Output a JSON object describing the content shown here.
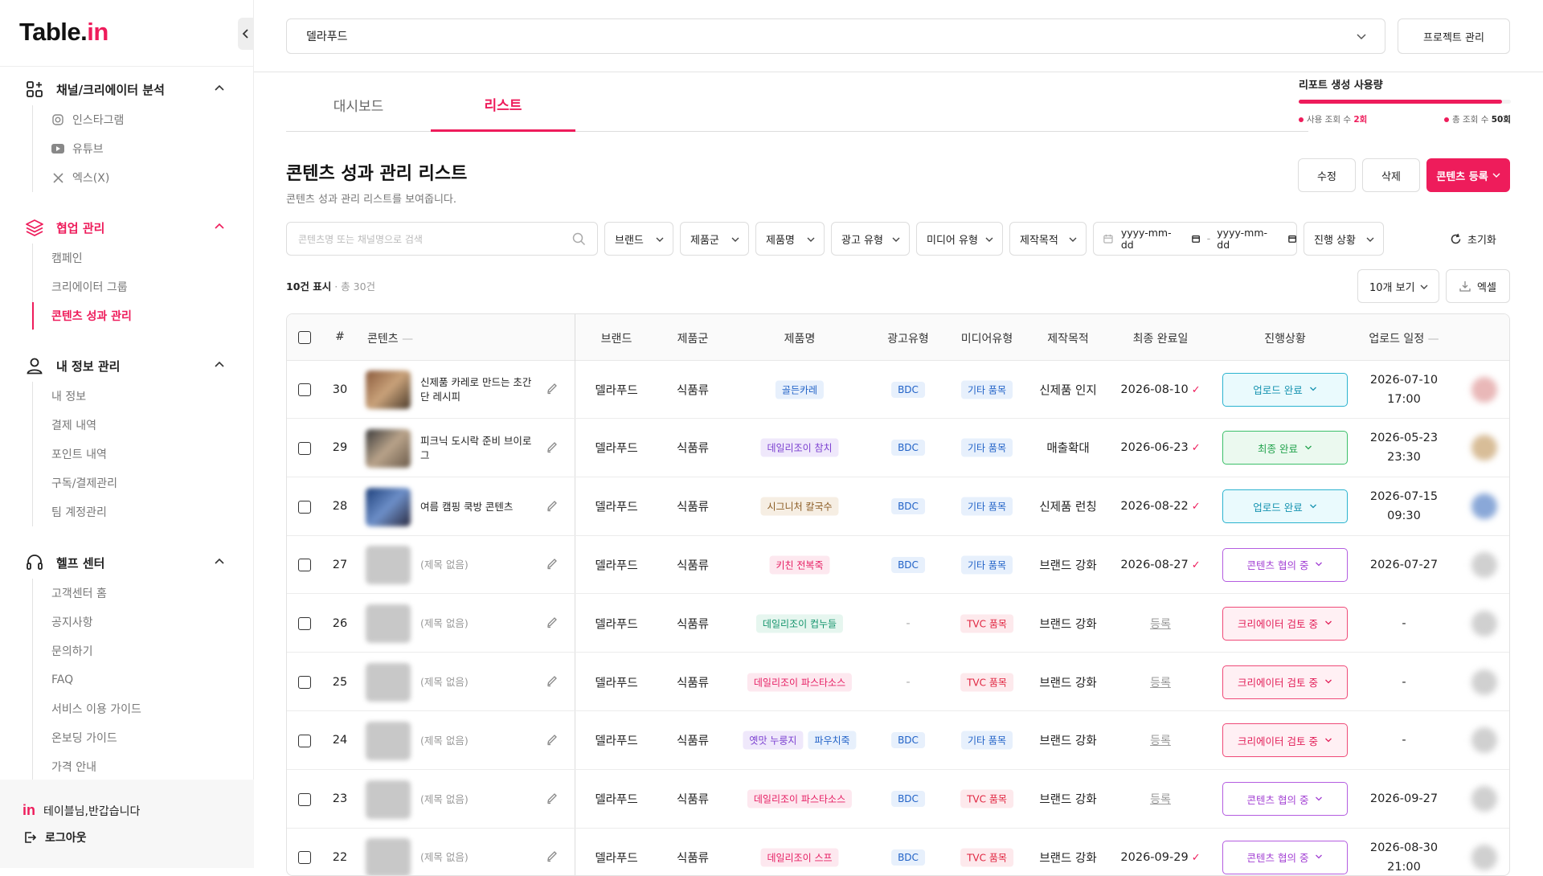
{
  "app": {
    "logo_main": "Table.",
    "logo_accent": "in"
  },
  "sidebar": {
    "sections": [
      {
        "label": "채널/크리에이터 분석",
        "items": [
          {
            "label": "인스타그램"
          },
          {
            "label": "유튜브"
          },
          {
            "label": "엑스(X)"
          }
        ]
      },
      {
        "label": "협업 관리",
        "items": [
          {
            "label": "캠페인"
          },
          {
            "label": "크리에이터 그룹"
          },
          {
            "label": "콘텐츠 성과 관리"
          }
        ]
      },
      {
        "label": "내 정보 관리",
        "items": [
          {
            "label": "내 정보"
          },
          {
            "label": "결제 내역"
          },
          {
            "label": "포인트 내역"
          },
          {
            "label": "구독/결제관리"
          },
          {
            "label": "팀 계정관리"
          }
        ]
      },
      {
        "label": "헬프 센터",
        "items": [
          {
            "label": "고객센터 홈"
          },
          {
            "label": "공지사항"
          },
          {
            "label": "문의하기"
          },
          {
            "label": "FAQ"
          },
          {
            "label": "서비스 이용 가이드"
          },
          {
            "label": "온보딩 가이드"
          },
          {
            "label": "가격 안내"
          }
        ]
      }
    ],
    "footer": {
      "greeting": "테이블님,반갑습니다",
      "logout": "로그아웃"
    }
  },
  "header": {
    "project_select": "델라푸드",
    "manage_button": "프로젝트 관리"
  },
  "tabs": [
    {
      "label": "대시보드"
    },
    {
      "label": "리스트"
    }
  ],
  "usage": {
    "title": "리포트 생성 사용량",
    "used_label": "사용 조회 수",
    "used_value": "2회",
    "total_label": "총 조회 수",
    "total_value": "50회",
    "ratio": 0.96
  },
  "page": {
    "title": "콘텐츠 성과 관리 리스트",
    "subtitle": "콘텐츠 성과 관리 리스트를 보여줍니다."
  },
  "actions": {
    "edit": "수정",
    "delete": "삭제",
    "register": "콘텐츠 등록"
  },
  "filters": {
    "search_placeholder": "콘텐츠명 또는 채널명으로 검색",
    "brand": "브랜드",
    "category": "제품군",
    "product": "제품명",
    "ad_type": "광고 유형",
    "media_type": "미디어 유형",
    "purpose": "제작목적",
    "date_from": "yyyy-mm-dd",
    "date_to": "yyyy-mm-dd",
    "progress": "진행 상황",
    "reset": "초기화"
  },
  "list_meta": {
    "shown": "10건 표시",
    "total": "· 총 30건",
    "per_page": "10개 보기",
    "excel": "엑셀"
  },
  "table": {
    "headers": {
      "num": "#",
      "content": "콘텐츠",
      "brand": "브랜드",
      "category": "제품군",
      "product": "제품명",
      "ad_type": "광고유형",
      "media_type": "미디어유형",
      "purpose": "제작목적",
      "final_date": "최종 완료일",
      "status": "진행상황",
      "upload": "업로드 일정"
    },
    "rows": [
      {
        "num": "30",
        "title": "신제품 카레로 만드는 초간단 레시피",
        "brand": "델라푸드",
        "category": "식품류",
        "products": [
          {
            "label": "골든카레",
            "color": "blue"
          }
        ],
        "ad_type": "BDC",
        "media": "기타 품목",
        "media_color": "blue",
        "purpose": "신제품 인지",
        "final_date": "2026-08-10",
        "final_check": true,
        "status": "업로드 완료",
        "status_kind": "upload",
        "upload_date": "2026-07-10",
        "upload_time": "17:00"
      },
      {
        "num": "29",
        "title": "피크닉 도시락 준비 브이로그",
        "brand": "델라푸드",
        "category": "식품류",
        "products": [
          {
            "label": "데일리조이 참치",
            "color": "purple"
          }
        ],
        "ad_type": "BDC",
        "media": "기타 품목",
        "media_color": "blue",
        "purpose": "매출확대",
        "final_date": "2026-06-23",
        "final_check": true,
        "status": "최종 완료",
        "status_kind": "final",
        "upload_date": "2026-05-23",
        "upload_time": "23:30"
      },
      {
        "num": "28",
        "title": "여름 캠핑 쿡방 콘텐츠",
        "brand": "델라푸드",
        "category": "식품류",
        "products": [
          {
            "label": "시그니처 칼국수",
            "color": "brown"
          }
        ],
        "ad_type": "BDC",
        "media": "기타 품목",
        "media_color": "blue",
        "purpose": "신제품 런칭",
        "final_date": "2026-08-22",
        "final_check": true,
        "status": "업로드 완료",
        "status_kind": "upload",
        "upload_date": "2026-07-15",
        "upload_time": "09:30"
      },
      {
        "num": "27",
        "title": "(제목 없음)",
        "brand": "델라푸드",
        "category": "식품류",
        "products": [
          {
            "label": "키친 전복죽",
            "color": "pink"
          }
        ],
        "ad_type": "BDC",
        "media": "기타 품목",
        "media_color": "blue",
        "purpose": "브랜드 강화",
        "final_date": "2026-08-27",
        "final_check": true,
        "status": "콘텐츠 협의 중",
        "status_kind": "consult",
        "upload_date": "2026-07-27",
        "upload_time": ""
      },
      {
        "num": "26",
        "title": "(제목 없음)",
        "brand": "델라푸드",
        "category": "식품류",
        "products": [
          {
            "label": "데일리조이 컵누들",
            "color": "green"
          }
        ],
        "ad_type": "-",
        "media": "TVC 품목",
        "media_color": "red",
        "purpose": "브랜드 강화",
        "final_date": "등록",
        "final_check": false,
        "status": "크리에이터 검토 중",
        "status_kind": "review",
        "upload_date": "-",
        "upload_time": ""
      },
      {
        "num": "25",
        "title": "(제목 없음)",
        "brand": "델라푸드",
        "category": "식품류",
        "products": [
          {
            "label": "데일리조이 파스타소스",
            "color": "pink"
          }
        ],
        "ad_type": "-",
        "media": "TVC 품목",
        "media_color": "red",
        "purpose": "브랜드 강화",
        "final_date": "등록",
        "final_check": false,
        "status": "크리에이터 검토 중",
        "status_kind": "review",
        "upload_date": "-",
        "upload_time": ""
      },
      {
        "num": "24",
        "title": "(제목 없음)",
        "brand": "델라푸드",
        "category": "식품류",
        "products": [
          {
            "label": "옛맛 누룽지",
            "color": "purple"
          },
          {
            "label": "파우치죽",
            "color": "blue"
          }
        ],
        "ad_type": "BDC",
        "media": "기타 품목",
        "media_color": "blue",
        "purpose": "브랜드 강화",
        "final_date": "등록",
        "final_check": false,
        "status": "크리에이터 검토 중",
        "status_kind": "review",
        "upload_date": "-",
        "upload_time": ""
      },
      {
        "num": "23",
        "title": "(제목 없음)",
        "brand": "델라푸드",
        "category": "식품류",
        "products": [
          {
            "label": "데일리조이 파스타소스",
            "color": "pink"
          }
        ],
        "ad_type": "BDC",
        "media": "TVC 품목",
        "media_color": "red",
        "purpose": "브랜드 강화",
        "final_date": "등록",
        "final_check": false,
        "status": "콘텐츠 협의 중",
        "status_kind": "consult",
        "upload_date": "2026-09-27",
        "upload_time": ""
      },
      {
        "num": "22",
        "title": "(제목 없음)",
        "brand": "델라푸드",
        "category": "식품류",
        "products": [
          {
            "label": "데일리조이 스프",
            "color": "pink"
          }
        ],
        "ad_type": "BDC",
        "media": "TVC 품목",
        "media_color": "red",
        "purpose": "브랜드 강화",
        "final_date": "2026-09-29",
        "final_check": true,
        "status": "콘텐츠 협의 중",
        "status_kind": "consult",
        "upload_date": "2026-08-30",
        "upload_time": "21:00"
      }
    ]
  },
  "colors": {
    "accent": "#ee1c5b"
  }
}
